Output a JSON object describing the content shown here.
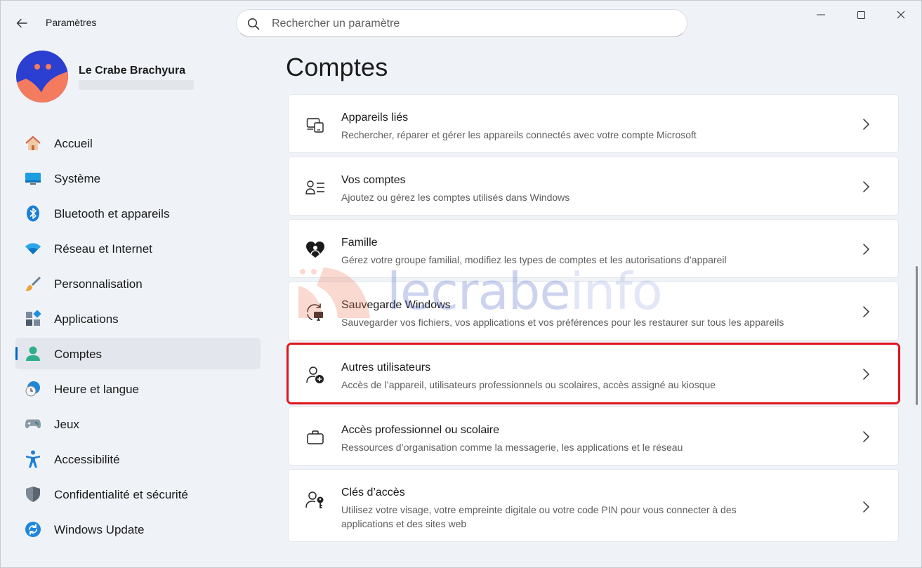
{
  "window": {
    "title": "Paramètres"
  },
  "search": {
    "placeholder": "Rechercher un paramètre"
  },
  "user": {
    "name": "Le Crabe Brachyura"
  },
  "nav": {
    "items": [
      {
        "label": "Accueil",
        "icon": "home-icon"
      },
      {
        "label": "Système",
        "icon": "monitor-icon"
      },
      {
        "label": "Bluetooth et appareils",
        "icon": "bluetooth-icon"
      },
      {
        "label": "Réseau et Internet",
        "icon": "wifi-icon"
      },
      {
        "label": "Personnalisation",
        "icon": "brush-icon"
      },
      {
        "label": "Applications",
        "icon": "apps-icon"
      },
      {
        "label": "Comptes",
        "icon": "person-icon",
        "active": true
      },
      {
        "label": "Heure et langue",
        "icon": "clock-globe-icon"
      },
      {
        "label": "Jeux",
        "icon": "gamepad-icon"
      },
      {
        "label": "Accessibilité",
        "icon": "accessibility-icon"
      },
      {
        "label": "Confidentialité et sécurité",
        "icon": "shield-icon"
      },
      {
        "label": "Windows Update",
        "icon": "update-icon"
      }
    ]
  },
  "main": {
    "title": "Comptes",
    "cards": [
      {
        "title": "Appareils liés",
        "desc": "Rechercher, réparer et gérer les appareils connectés avec votre compte Microsoft",
        "icon": "linked-devices-icon"
      },
      {
        "title": "Vos comptes",
        "desc": "Ajoutez ou gérez les comptes utilisés dans Windows",
        "icon": "accounts-list-icon"
      },
      {
        "title": "Famille",
        "desc": "Gérez votre groupe familial, modifiez les types de comptes et les autorisations d’appareil",
        "icon": "family-heart-icon"
      },
      {
        "title": "Sauvegarde Windows",
        "desc": "Sauvegarder vos fichiers, vos applications et vos préférences pour les restaurer sur tous les appareils",
        "icon": "backup-icon"
      },
      {
        "title": "Autres utilisateurs",
        "desc": "Accès de l’appareil, utilisateurs professionnels ou scolaires, accès assigné au kiosque",
        "icon": "add-user-icon",
        "highlighted": true
      },
      {
        "title": "Accès professionnel ou scolaire",
        "desc": "Ressources d’organisation comme la messagerie, les applications et le réseau",
        "icon": "briefcase-icon"
      },
      {
        "title": "Clés d’accès",
        "desc": "Utilisez votre visage, votre empreinte digitale ou votre code PIN pour vous connecter à des applications et des sites web",
        "icon": "passkey-icon"
      }
    ]
  },
  "watermark": {
    "text_a": "lecrabe",
    "text_b": "info"
  },
  "colors": {
    "accent": "#0067c0",
    "highlight_border": "#e0131c",
    "background": "#eff3f8"
  }
}
